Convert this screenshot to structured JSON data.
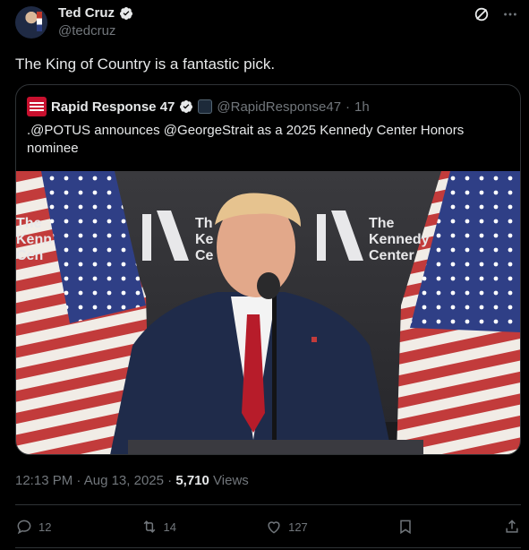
{
  "author": {
    "display_name": "Ted Cruz",
    "handle": "@tedcruz",
    "avatar_icon": "profile-avatar"
  },
  "top_icons": [
    "grok-icon",
    "more-icon"
  ],
  "tweet_text": "The King of Country is a fantastic pick.",
  "quote": {
    "display_name": "Rapid Response 47",
    "handle": "@RapidResponse47",
    "separator": "·",
    "time": "1h",
    "text": ".@POTUS announces @GeorgeStrait as a 2025 Kennedy Center Honors nominee",
    "media": {
      "backdrop_logo_text": [
        "The",
        "Kennedy",
        "Center"
      ],
      "backdrop_logo_text_partial_left": [
        "The",
        "Kenn",
        "Cen"
      ],
      "backdrop_logo_text_partial_center": [
        "Th",
        "Ke",
        "Ce"
      ]
    }
  },
  "meta": {
    "time": "12:13 PM",
    "separator": "·",
    "date": "Aug 13, 2025",
    "separator2": "·",
    "views_count": "5,710",
    "views_label": "Views"
  },
  "actions": {
    "replies": "12",
    "reposts": "14",
    "likes": "127"
  },
  "colors": {
    "background": "#000000",
    "text": "#e7e9ea",
    "muted": "#71767b",
    "border": "#2f3336",
    "verified": "#1d9bf0"
  }
}
